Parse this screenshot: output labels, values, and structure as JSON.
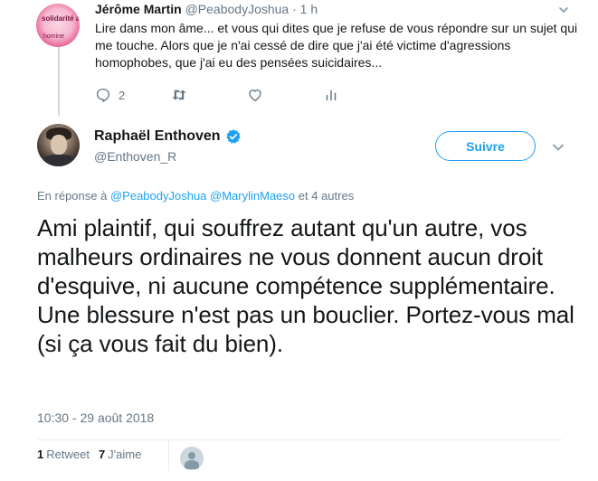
{
  "parent_tweet": {
    "avatar_text_top": "solidarité a",
    "avatar_text_bottom": "homine",
    "name": "Jérôme Martin",
    "handle": "@PeabodyJoshua",
    "dot": "·",
    "time": "1 h",
    "text": "Lire dans mon âme... et vous qui dites que je refuse de vous répondre sur un sujet qui me touche. Alors que je n'ai cessé de dire que j'ai été victime d'agressions homophobes, que j'ai eu des pensées suicidaires...",
    "reply_count": "2",
    "icons": {
      "reply": "reply-icon",
      "retweet": "retweet-icon",
      "like": "heart-icon",
      "analytics": "analytics-icon",
      "more": "chevron-down-icon"
    }
  },
  "main_tweet": {
    "name": "Raphaël Enthoven",
    "handle": "@Enthoven_R",
    "verified": true,
    "follow_label": "Suivre",
    "reply_prefix": "En réponse à",
    "reply_mention_1": "@PeabodyJoshua",
    "reply_mention_2": "@MarylinMaeso",
    "reply_suffix": "et 4 autres",
    "text": "Ami plaintif, qui souffrez autant qu'un autre, vos malheurs ordinaires ne vous donnent aucun droit d'esquive, ni aucune compétence supplémentaire. Une blessure n'est pas un bouclier. Portez-vous mal (si ça vous fait du bien).",
    "timestamp": "10:30 - 29 août 2018",
    "retweets_count": "1",
    "retweets_label": "Retweet",
    "likes_count": "7",
    "likes_label": "J'aime"
  },
  "colors": {
    "accent": "#1da1f2",
    "muted": "#657786",
    "text": "#14171a",
    "divider": "#e6ecf0"
  }
}
